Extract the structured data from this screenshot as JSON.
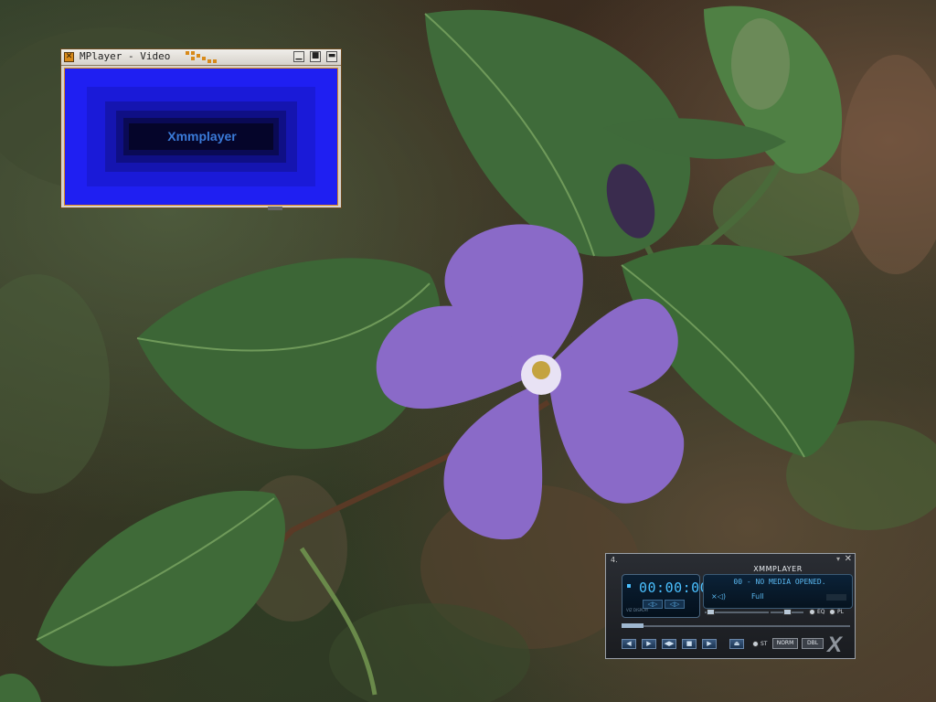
{
  "desktop": {
    "wallpaper": "periwinkle flower photo"
  },
  "mplayer_window": {
    "title": "MPlayer - Video",
    "logo_text": "Xmmplayer",
    "accent_color": "#e08a20",
    "video_bg_color": "#1a1aee",
    "icons": [
      "close-icon",
      "minimize-icon",
      "maximize-icon",
      "close-icon"
    ]
  },
  "xmmplayer": {
    "title": "XMMPLAYER",
    "time": "00:00:00",
    "viz_label": "VIZ DISPLAY",
    "song": "00 - NO MEDIA OPENED.",
    "mute_symbol": "×◁)",
    "mode": "Full",
    "eq_label": "EQ",
    "pl_label": "PL",
    "st_label": "ST",
    "norm_label": "NORM",
    "dbl_label": "DBL",
    "logo": "X",
    "lcd_color": "#4ac0ff"
  }
}
